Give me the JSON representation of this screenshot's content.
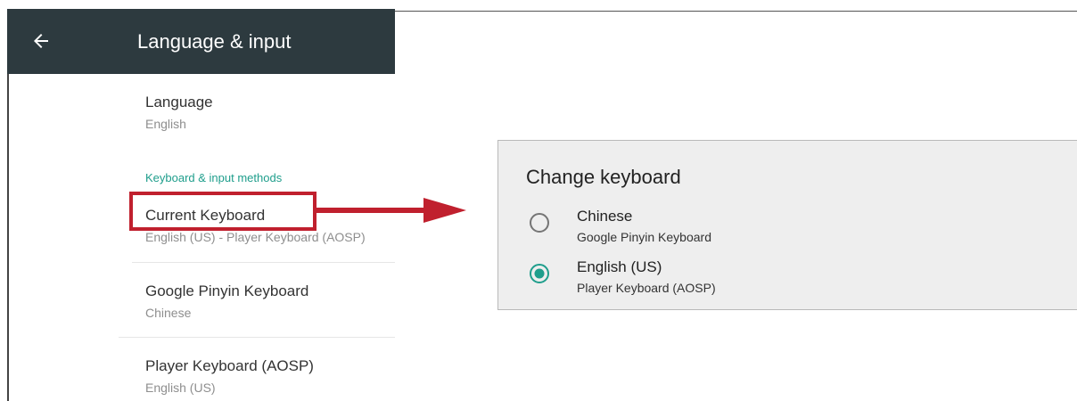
{
  "app_bar": {
    "title": "Language & input",
    "back_icon": "arrow-left-icon",
    "background": "#2d3a3f"
  },
  "settings": {
    "language": {
      "title": "Language",
      "summary": "English"
    },
    "section_header": "Keyboard & input methods",
    "current_keyboard": {
      "title": "Current Keyboard",
      "summary": "English (US) - Player Keyboard (AOSP)"
    },
    "pinyin": {
      "title": "Google Pinyin Keyboard",
      "summary": "Chinese"
    },
    "player": {
      "title": "Player Keyboard (AOSP)",
      "summary": "English (US)"
    }
  },
  "dialog": {
    "title": "Change keyboard",
    "options": [
      {
        "title": "Chinese",
        "subtitle": "Google Pinyin Keyboard",
        "selected": false
      },
      {
        "title": "English (US)",
        "subtitle": "Player Keyboard (AOSP)",
        "selected": true
      }
    ]
  },
  "annotation": {
    "color": "#c0202e",
    "icon": "arrow-right-icon"
  },
  "colors": {
    "accent": "#1f9e8c",
    "dialog_background": "#eeeeee"
  }
}
